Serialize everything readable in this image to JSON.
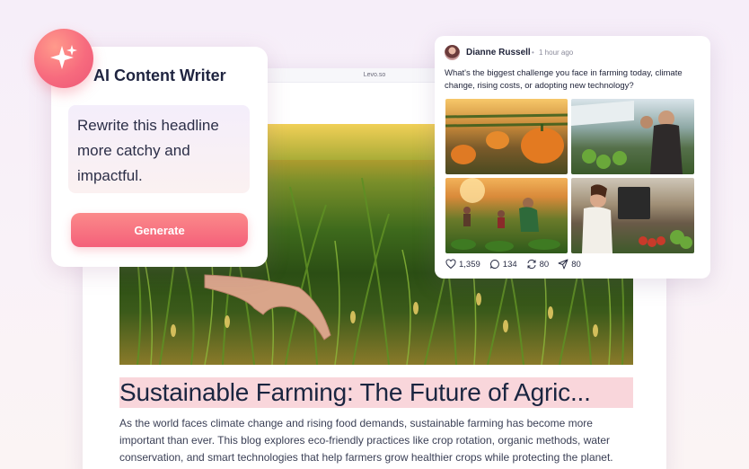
{
  "editor": {
    "url": "Levo.so",
    "headline": "Sustainable Farming: The Future of Agric...",
    "body": "As the world faces climate change and rising food demands, sustainable farming has become more important than ever. This blog explores eco-friendly practices like crop rotation, organic methods, water conservation, and smart technologies that help farmers grow healthier crops while protecting the planet."
  },
  "ai_card": {
    "title": "AI Content Writer",
    "prompt": "Rewrite this headline more catchy and impactful.",
    "button_label": "Generate"
  },
  "post": {
    "author": "Dianne Russell",
    "time": "1 hour ago",
    "text": "What's the biggest challenge you face in farming today, climate change, rising costs, or adopting new technology?",
    "likes": "1,359",
    "comments": "134",
    "reposts": "80",
    "shares": "80"
  },
  "icons": {
    "badge": "sparkle-icon",
    "like": "heart-icon",
    "comment": "comment-icon",
    "repost": "repost-icon",
    "share": "send-icon"
  },
  "colors": {
    "accent": "#f4607a",
    "headline_highlight": "#f9d6db",
    "text_dark": "#1a2540"
  }
}
